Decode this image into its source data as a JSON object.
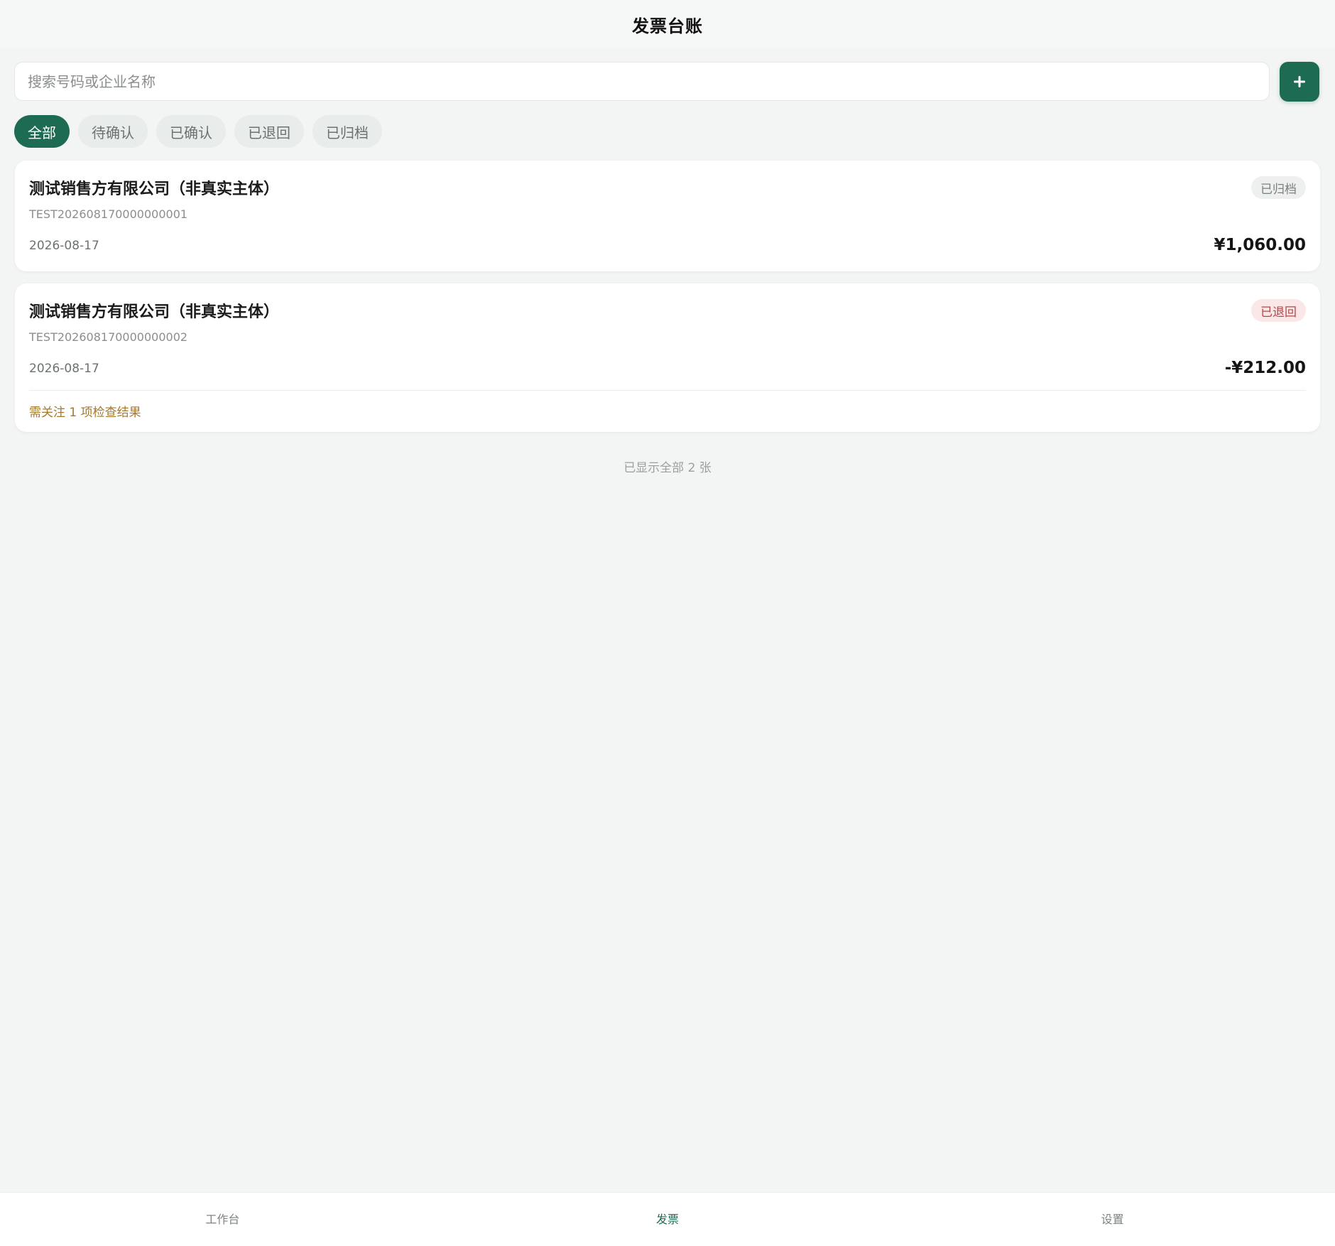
{
  "header": {
    "title": "发票台账"
  },
  "search": {
    "placeholder": "搜索号码或企业名称",
    "value": ""
  },
  "add_button": {
    "icon": "plus-icon"
  },
  "filters": [
    {
      "label": "全部",
      "active": true
    },
    {
      "label": "待确认",
      "active": false
    },
    {
      "label": "已确认",
      "active": false
    },
    {
      "label": "已退回",
      "active": false
    },
    {
      "label": "已归档",
      "active": false
    }
  ],
  "invoices": [
    {
      "seller": "测试销售方有限公司（非真实主体）",
      "number": "TEST202608170000000001",
      "date": "2026-08-17",
      "amount": "¥1,060.00",
      "status": "已归档",
      "status_color": "#7a807d"
    },
    {
      "seller": "测试销售方有限公司（非真实主体）",
      "number": "TEST202608170000000002",
      "date": "2026-08-17",
      "amount": "-¥212.00",
      "status": "已退回",
      "status_color": "#b24848",
      "attention": "需关注 1 项检查结果"
    }
  ],
  "footer_note": "已显示全部 2 张",
  "bottom_nav": [
    {
      "label": "工作台",
      "active": false
    },
    {
      "label": "发票",
      "active": true
    },
    {
      "label": "设置",
      "active": false
    }
  ],
  "colors": {
    "accent": "#1d6b53",
    "background": "#f3f5f4",
    "warning": "#a6782d"
  }
}
